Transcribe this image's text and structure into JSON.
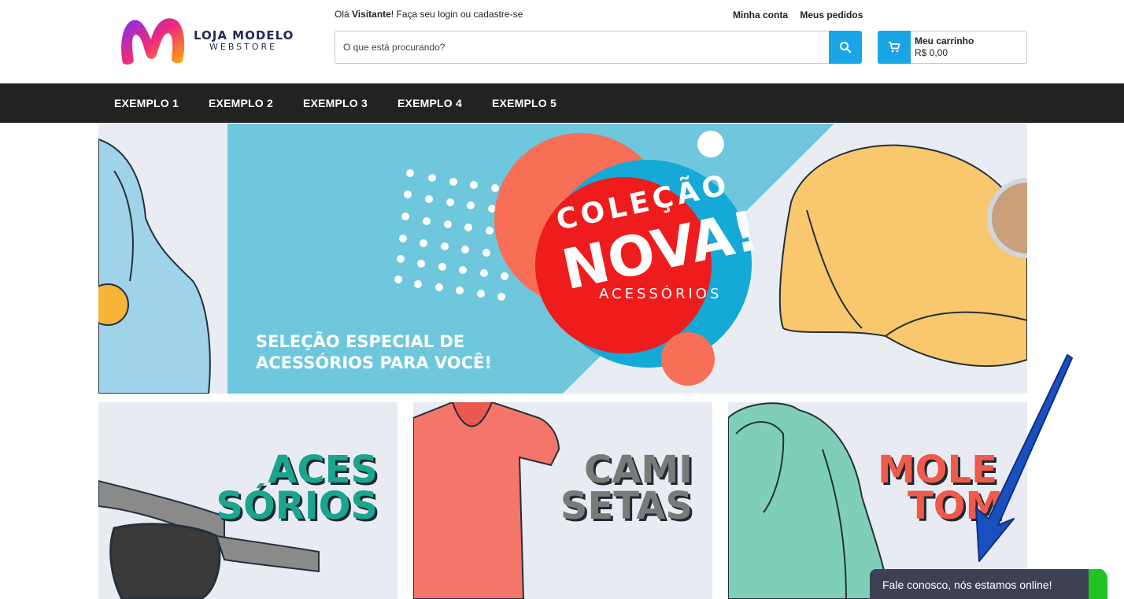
{
  "header": {
    "logo_text": "LOJA MODELO",
    "logo_sub": "WEBSTORE",
    "welcome_prefix": "Olá ",
    "welcome_user": "Visitante",
    "welcome_suffix": "! Faça seu login ou cadastre-se",
    "links": [
      "Minha conta",
      "Meus pedidos"
    ],
    "search_placeholder": "O que está procurando?",
    "cart_title": "Meu carrinho",
    "cart_total": "R$ 0,00"
  },
  "nav": {
    "items": [
      "EXEMPLO 1",
      "EXEMPLO 2",
      "EXEMPLO 3",
      "EXEMPLO 4",
      "EXEMPLO 5"
    ]
  },
  "banner": {
    "line1": "COLEÇÃO",
    "line2": "NOVA!",
    "line3": "ACESSÓRIOS",
    "tagline1": "SELEÇÃO ESPECIAL DE",
    "tagline2": "ACESSÓRIOS PARA VOCÊ!"
  },
  "categories": [
    {
      "line1": "ACES",
      "line2": "SÓRIOS",
      "color": "#1aa58e"
    },
    {
      "line1": "CAMI",
      "line2": "SETAS",
      "color": "#7a7a7a"
    },
    {
      "line1": "MOLE",
      "line2": "TOM",
      "color": "#ef5a4a"
    }
  ],
  "chat": {
    "label": "Fale conosco, nós estamos online!"
  },
  "colors": {
    "accent": "#1aa6e6",
    "nav_bg": "#222222",
    "banner_red": "#ee1c1c",
    "banner_coral": "#f76f57",
    "banner_blue": "#6ec7dc",
    "chat_bg": "#3d4153",
    "online": "#22c322"
  }
}
